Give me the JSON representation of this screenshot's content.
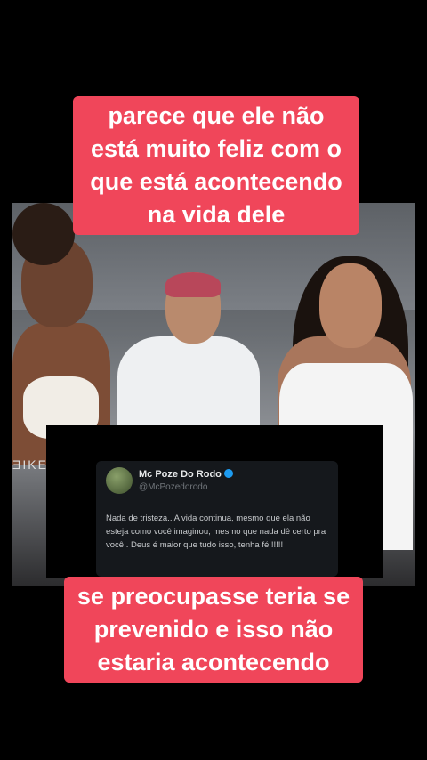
{
  "top_caption": "parece que ele não está muito feliz com o que está acontecendo na vida dele",
  "bottom_caption": "se preocupasse teria se prevenido e isso não estaria acontecendo",
  "photo_sign": "ƎIKE",
  "tweet": {
    "name": "Mc Poze Do Rodo",
    "handle": "@McPozedorodo",
    "text": "Nada de tristeza.. A vida continua, mesmo que ela não esteja como você imaginou, mesmo que nada dê certo pra você.. Deus é maior que tudo isso, tenha fé!!!!!!"
  },
  "colors": {
    "caption_bg": "#f0465a",
    "background": "#000000",
    "verified": "#1d9bf0"
  }
}
